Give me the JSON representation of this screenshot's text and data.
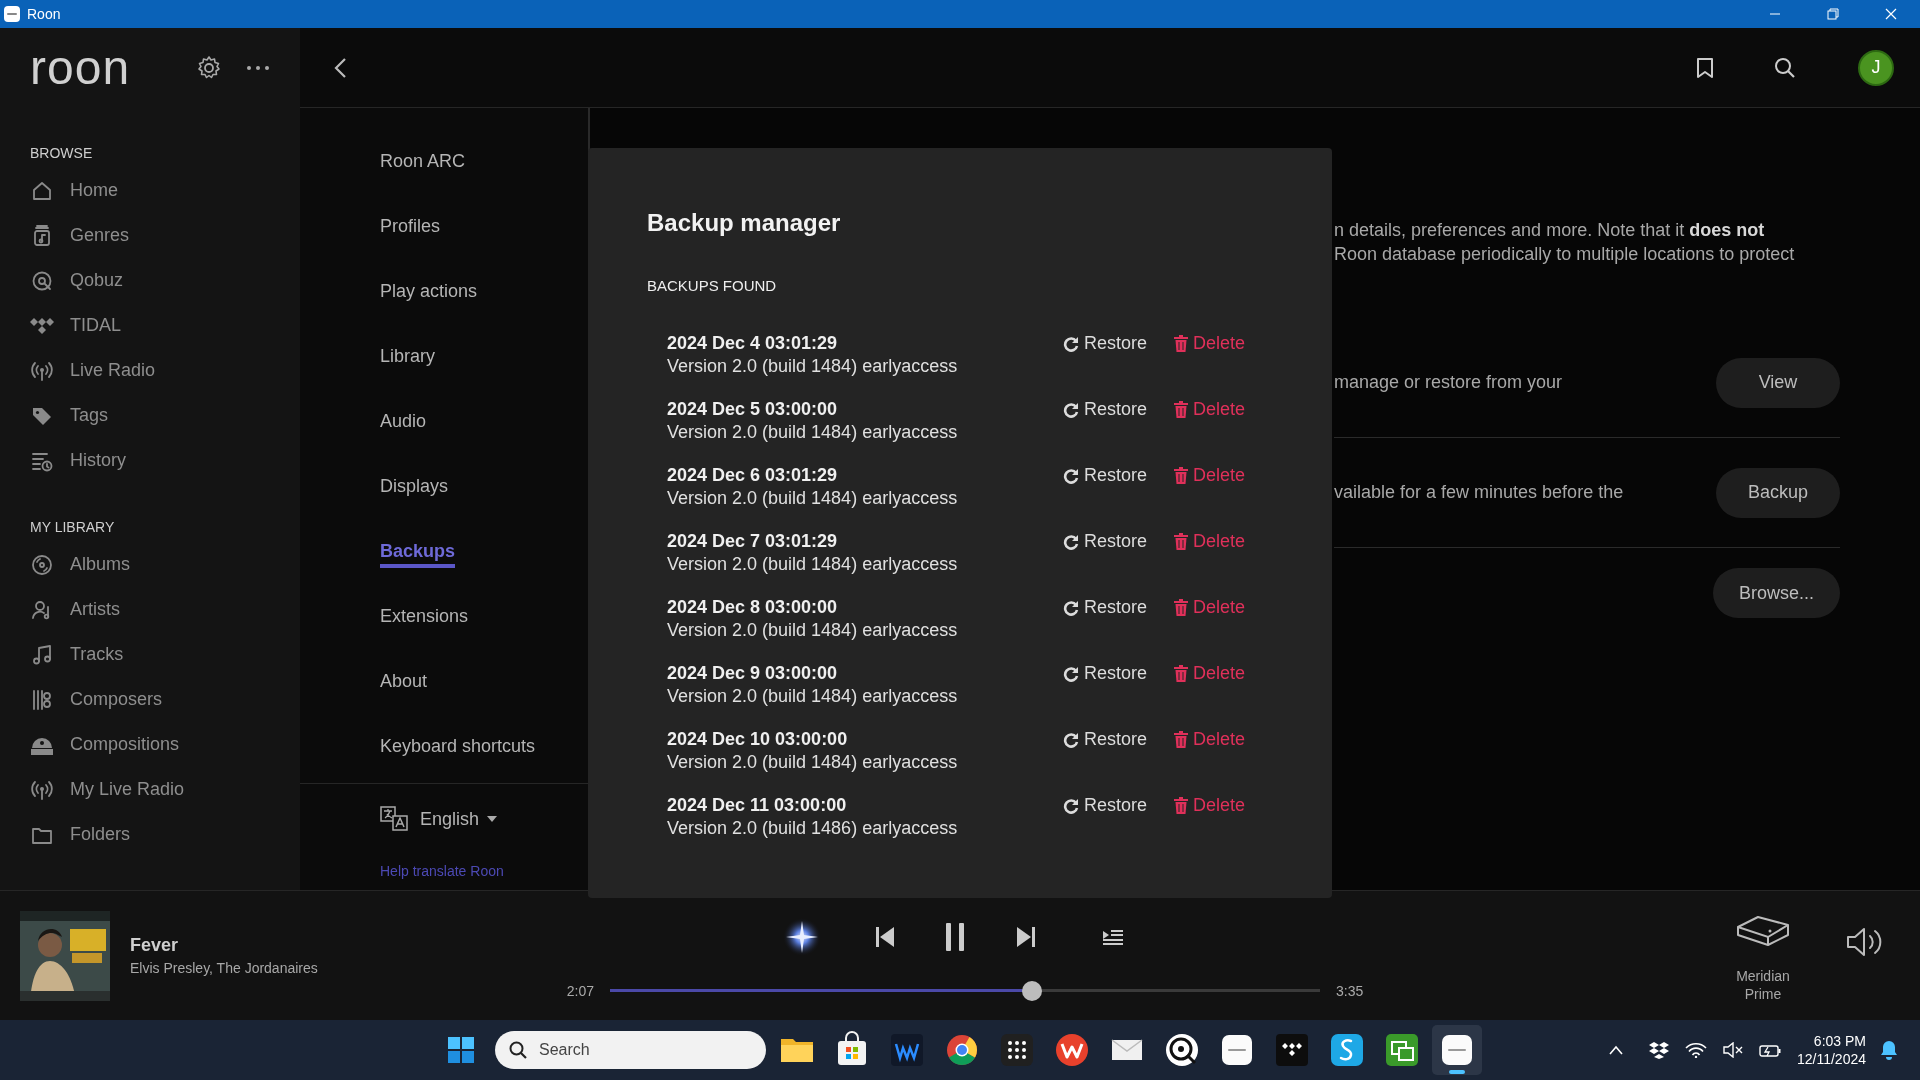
{
  "window": {
    "title": "Roon"
  },
  "sidebar": {
    "logo": "roon",
    "sections": [
      {
        "heading": "BROWSE",
        "items": [
          {
            "label": "Home"
          },
          {
            "label": "Genres"
          },
          {
            "label": "Qobuz"
          },
          {
            "label": "TIDAL"
          },
          {
            "label": "Live Radio"
          },
          {
            "label": "Tags"
          },
          {
            "label": "History"
          }
        ]
      },
      {
        "heading": "MY LIBRARY",
        "items": [
          {
            "label": "Albums"
          },
          {
            "label": "Artists"
          },
          {
            "label": "Tracks"
          },
          {
            "label": "Composers"
          },
          {
            "label": "Compositions"
          },
          {
            "label": "My Live Radio"
          },
          {
            "label": "Folders"
          }
        ]
      }
    ]
  },
  "user": {
    "initial": "J"
  },
  "settings_nav": {
    "items": [
      {
        "label": "Roon ARC",
        "selected": false
      },
      {
        "label": "Profiles",
        "selected": false
      },
      {
        "label": "Play actions",
        "selected": false
      },
      {
        "label": "Library",
        "selected": false
      },
      {
        "label": "Audio",
        "selected": false
      },
      {
        "label": "Displays",
        "selected": false
      },
      {
        "label": "Backups",
        "selected": true
      },
      {
        "label": "Extensions",
        "selected": false
      },
      {
        "label": "About",
        "selected": false
      },
      {
        "label": "Keyboard shortcuts",
        "selected": false
      }
    ],
    "language": "English",
    "help_link": "Help translate Roon"
  },
  "backup_settings": {
    "intro_lines": [
      "n details, preferences and more. Note that it **does not**",
      "Roon database periodically to multiple locations to protect"
    ],
    "rows": [
      {
        "text": "manage or restore from your",
        "button": "View"
      },
      {
        "text": "vailable for a few minutes before the",
        "button": "Backup"
      },
      {
        "button": "Browse..."
      }
    ]
  },
  "modal": {
    "title": "Backup manager",
    "section_heading": "BACKUPS FOUND",
    "backups": [
      {
        "date": "2024 Dec 4 03:01:29",
        "version": "Version 2.0 (build 1484) earlyaccess",
        "restore": "Restore",
        "delete": "Delete"
      },
      {
        "date": "2024 Dec 5 03:00:00",
        "version": "Version 2.0 (build 1484) earlyaccess",
        "restore": "Restore",
        "delete": "Delete"
      },
      {
        "date": "2024 Dec 6 03:01:29",
        "version": "Version 2.0 (build 1484) earlyaccess",
        "restore": "Restore",
        "delete": "Delete"
      },
      {
        "date": "2024 Dec 7 03:01:29",
        "version": "Version 2.0 (build 1484) earlyaccess",
        "restore": "Restore",
        "delete": "Delete"
      },
      {
        "date": "2024 Dec 8 03:00:00",
        "version": "Version 2.0 (build 1484) earlyaccess",
        "restore": "Restore",
        "delete": "Delete"
      },
      {
        "date": "2024 Dec 9 03:00:00",
        "version": "Version 2.0 (build 1484) earlyaccess",
        "restore": "Restore",
        "delete": "Delete"
      },
      {
        "date": "2024 Dec 10 03:00:00",
        "version": "Version 2.0 (build 1484) earlyaccess",
        "restore": "Restore",
        "delete": "Delete"
      },
      {
        "date": "2024 Dec 11 03:00:00",
        "version": "Version 2.0 (build 1486) earlyaccess",
        "restore": "Restore",
        "delete": "Delete"
      }
    ]
  },
  "now_playing": {
    "title": "Fever",
    "artist": "Elvis Presley, The Jordanaires",
    "playing": true,
    "elapsed": "2:07",
    "duration": "3:35",
    "level": 0.594,
    "zone": "Meridian Prime"
  },
  "taskbar": {
    "search_placeholder": "Search",
    "apps": [
      {
        "kind": "files",
        "active": false
      },
      {
        "kind": "store",
        "active": false
      },
      {
        "kind": "waves",
        "active": false
      },
      {
        "kind": "browser",
        "active": false
      },
      {
        "kind": "launcher",
        "active": false
      },
      {
        "kind": "office",
        "active": false
      },
      {
        "kind": "mail",
        "active": false
      },
      {
        "kind": "disc",
        "active": false
      },
      {
        "kind": "tile",
        "active": false
      },
      {
        "kind": "diamonds",
        "active": false
      },
      {
        "kind": "swirl",
        "active": false
      },
      {
        "kind": "remote",
        "active": false
      },
      {
        "kind": "tile",
        "active": true
      }
    ],
    "time": "6:03 PM",
    "date": "12/11/2024"
  }
}
